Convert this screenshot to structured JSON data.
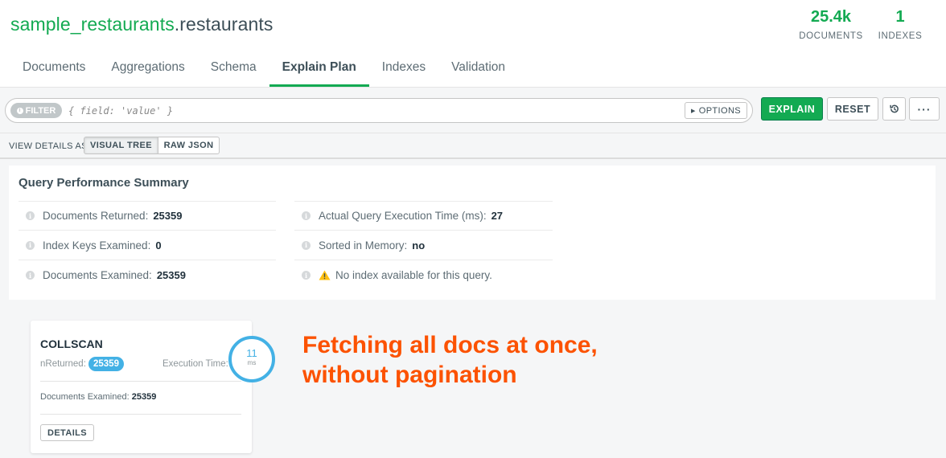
{
  "collection": {
    "db": "sample_restaurants",
    "name": ".restaurants"
  },
  "stats": [
    {
      "value": "25.4k",
      "label": "DOCUMENTS"
    },
    {
      "value": "1",
      "label": "INDEXES"
    }
  ],
  "tabs": [
    "Documents",
    "Aggregations",
    "Schema",
    "Explain Plan",
    "Indexes",
    "Validation"
  ],
  "active_tab": "Explain Plan",
  "filter": {
    "label": "FILTER",
    "placeholder": "{ field: 'value' }",
    "options_label": "OPTIONS"
  },
  "toolbar": {
    "explain_label": "EXPLAIN",
    "reset_label": "RESET",
    "more_label": "···"
  },
  "view": {
    "label": "VIEW DETAILS AS",
    "visual_label": "VISUAL TREE",
    "raw_label": "RAW JSON"
  },
  "summary": {
    "title": "Query Performance Summary",
    "left": [
      {
        "label": "Documents Returned:",
        "value": "25359"
      },
      {
        "label": "Index Keys Examined:",
        "value": "0"
      },
      {
        "label": "Documents Examined:",
        "value": "25359"
      }
    ],
    "right": [
      {
        "label": "Actual Query Execution Time (ms):",
        "value": "27"
      },
      {
        "label": "Sorted in Memory:",
        "value": "no"
      },
      {
        "label": "No index available for this query.",
        "value": ""
      }
    ]
  },
  "stage": {
    "name": "COLLSCAN",
    "nreturned_label": "nReturned:",
    "nreturned": "25359",
    "exec_label": "Execution Time:",
    "exec_time": "11",
    "exec_unit": "ms",
    "docs_examined_label": "Documents Examined:",
    "docs_examined": "25359",
    "details_label": "DETAILS"
  },
  "annotation": "Fetching all docs at once,\nwithout pagination",
  "colors": {
    "brand_green": "#13aa52",
    "accent_blue": "#43b1e5",
    "annotation_orange": "#fc5200",
    "warning_yellow": "#ffc010"
  }
}
